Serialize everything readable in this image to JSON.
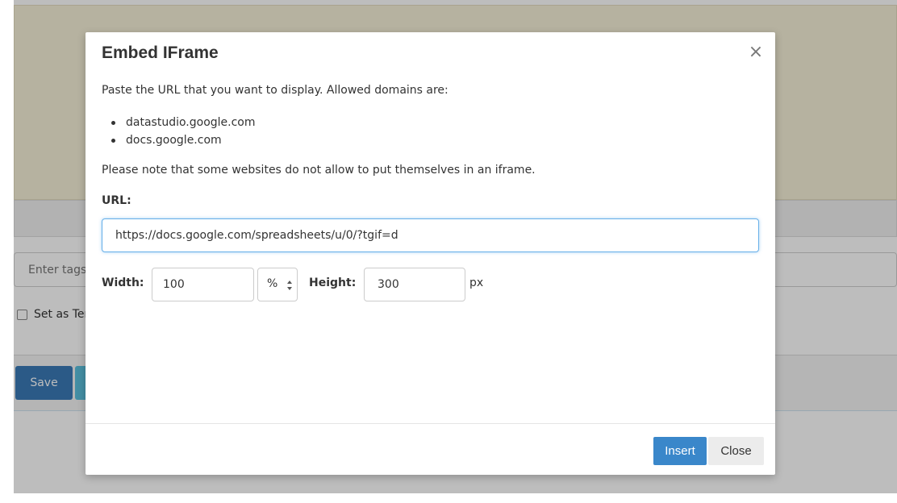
{
  "background": {
    "tag_placeholder": "Enter tags",
    "set_as_label": "Set as Template",
    "save_label": "Save"
  },
  "modal": {
    "title": "Embed IFrame",
    "close_icon": "×",
    "intro": "Paste the URL that you want to display. Allowed domains are:",
    "allowed_domains": [
      "datastudio.google.com",
      "docs.google.com"
    ],
    "note": "Please note that some websites do not allow to put themselves in an iframe.",
    "url_label": "URL:",
    "url_value": "https://docs.google.com/spreadsheets/u/0/?tgif=d",
    "width_label": "Width:",
    "width_value": "100",
    "width_unit": "%",
    "height_label": "Height:",
    "height_value": "300",
    "height_unit": "px",
    "insert_label": "Insert",
    "close_label": "Close"
  },
  "colors": {
    "primary": "#3a87ca",
    "editor_bg": "#f6f0d8",
    "focus_ring": "#66afe9"
  },
  "icons": {
    "close": "close-icon",
    "unit_select": "updown-arrows-icon"
  }
}
